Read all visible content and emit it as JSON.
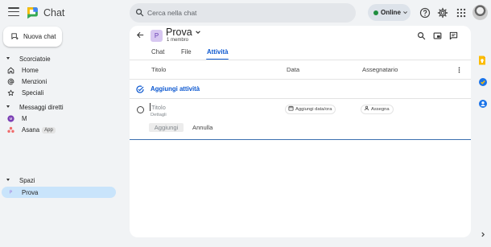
{
  "app": {
    "title": "Chat"
  },
  "search": {
    "placeholder": "Cerca nella chat"
  },
  "status": {
    "label": "Online",
    "color": "#1e8e3e"
  },
  "sidebar": {
    "new_chat_label": "Nuova chat",
    "shortcuts": {
      "header": "Scorciatoie",
      "items": [
        {
          "label": "Home",
          "icon": "home-icon"
        },
        {
          "label": "Menzioni",
          "icon": "at-icon"
        },
        {
          "label": "Speciali",
          "icon": "star-icon"
        }
      ]
    },
    "direct_messages": {
      "header": "Messaggi diretti",
      "items": [
        {
          "label": "M",
          "icon": "avatar-m"
        },
        {
          "label": "Asana",
          "badge": "App",
          "icon": "asana-icon"
        }
      ]
    },
    "spaces": {
      "header": "Spazi",
      "items": [
        {
          "label": "Prova",
          "avatar_letter": "P",
          "active": true
        }
      ]
    }
  },
  "space": {
    "name": "Prova",
    "avatar_letter": "P",
    "members": "1 membro",
    "tabs": [
      {
        "label": "Chat",
        "active": false
      },
      {
        "label": "File",
        "active": false
      },
      {
        "label": "Attività",
        "active": true
      }
    ]
  },
  "tasks": {
    "columns": {
      "title": "Titolo",
      "date": "Data",
      "assignee": "Assegnatario"
    },
    "add_task_label": "Aggiungi attività",
    "new_task": {
      "title_placeholder": "Titolo",
      "details_placeholder": "Dettagli",
      "date_chip": "Aggiungi data/ora",
      "assign_chip": "Assegna",
      "add_button": "Aggiungi",
      "cancel_button": "Annulla"
    }
  },
  "colors": {
    "accent": "#0b57d0",
    "active_item_bg": "#c9e4fb",
    "space_avatar_bg": "#d7c7f1",
    "online": "#1e8e3e"
  }
}
